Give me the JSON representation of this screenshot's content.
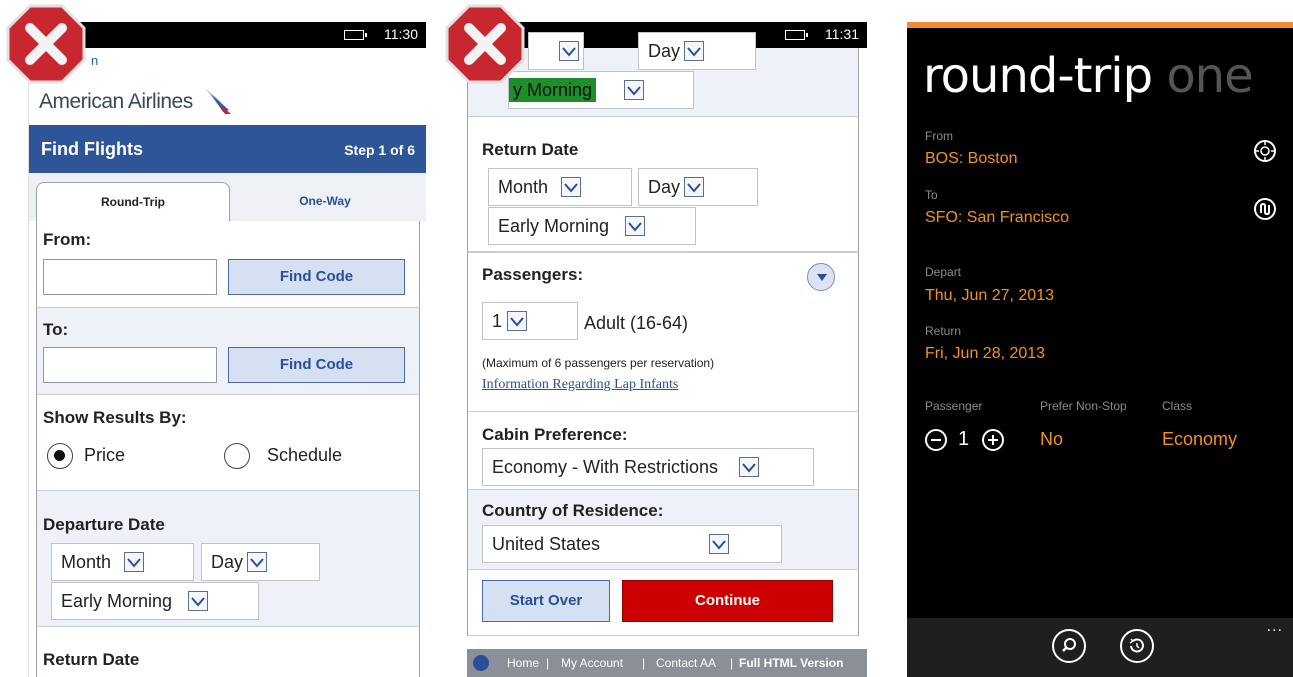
{
  "phone1": {
    "status_time": "11:30",
    "back_link": "n",
    "logo_text": "American Airlines",
    "header_title": "Find Flights",
    "header_step": "Step 1 of 6",
    "tab_round_trip": "Round-Trip",
    "tab_one_way": "One-Way",
    "from_label": "From:",
    "to_label": "To:",
    "find_code": "Find Code",
    "show_results_label": "Show Results By:",
    "radio_price": "Price",
    "radio_schedule": "Schedule",
    "departure_label": "Departure Date",
    "month": "Month",
    "day": "Day",
    "time": "Early Morning",
    "return_label": "Return Date"
  },
  "phone2": {
    "status_time": "11:31",
    "top_time_fragment": "y Morning",
    "top_day": "Day",
    "return_label": "Return Date",
    "month": "Month",
    "day": "Day",
    "time": "Early Morning",
    "passengers_label": "Passengers:",
    "pax_count": "1",
    "pax_type": "Adult (16-64)",
    "pax_note": "(Maximum of 6 passengers per reservation)",
    "lap_link": "Information Regarding Lap Infants",
    "cabin_label": "Cabin Preference:",
    "cabin_value": "Economy - With Restrictions",
    "country_label": "Country of Residence:",
    "country_value": "United States",
    "start_over": "Start Over",
    "continue": "Continue",
    "footer_home": "Home",
    "footer_account": "My Account",
    "footer_contact": "Contact AA",
    "footer_full": "Full HTML Version"
  },
  "phone3": {
    "title_active": "round-trip",
    "title_inactive": "one",
    "from_caption": "From",
    "from_value": "BOS: Boston",
    "to_caption": "To",
    "to_value": "SFO: San Francisco",
    "depart_caption": "Depart",
    "depart_value": "Thu, Jun 27, 2013",
    "return_caption": "Return",
    "return_value": "Fri, Jun 28, 2013",
    "passenger_caption": "Passenger",
    "passenger_value": "1",
    "nonstop_caption": "Prefer Non-Stop",
    "nonstop_value": "No",
    "class_caption": "Class",
    "class_value": "Economy",
    "more": "...",
    "accent_color": "#f2921c"
  },
  "icons": [
    "x-mark-icon",
    "location-icon",
    "swap-icon",
    "search-icon",
    "history-icon",
    "minus-icon",
    "plus-icon",
    "dropdown-arrow-icon",
    "expand-icon"
  ]
}
